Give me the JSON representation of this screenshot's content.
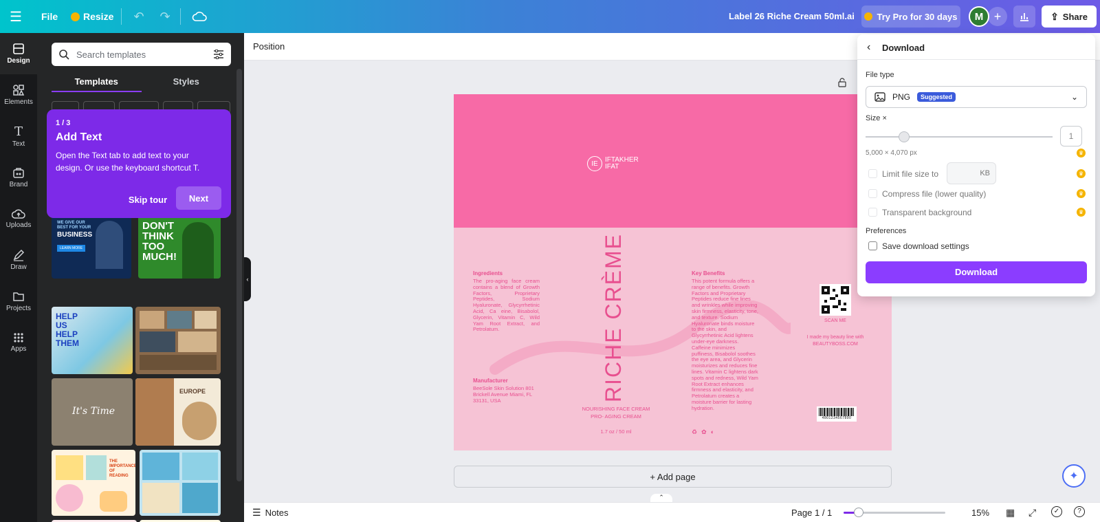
{
  "topbar": {
    "menu_icon": "hamburger-icon",
    "file_label": "File",
    "resize_label": "Resize",
    "doc_title": "Label 26 Riche Cream 50ml.ai",
    "try_pro_label": "Try Pro for 30 days",
    "avatar_letter": "M",
    "share_label": "Share"
  },
  "rail": {
    "items": [
      {
        "label": "Design",
        "icon": "design-icon"
      },
      {
        "label": "Elements",
        "icon": "elements-icon"
      },
      {
        "label": "Text",
        "icon": "text-icon"
      },
      {
        "label": "Brand",
        "icon": "brand-icon"
      },
      {
        "label": "Uploads",
        "icon": "uploads-icon"
      },
      {
        "label": "Draw",
        "icon": "draw-icon"
      },
      {
        "label": "Projects",
        "icon": "projects-icon"
      },
      {
        "label": "Apps",
        "icon": "apps-icon"
      }
    ]
  },
  "panel": {
    "search_placeholder": "Search templates",
    "tabs": [
      "Templates",
      "Styles"
    ],
    "thumbs": {
      "business_line1": "WE GIVE OUR",
      "business_line2": "BEST FOR YOUR",
      "business_line3": "BUSINESS",
      "business_cta": "LEARN MORE",
      "dont_think": "DON'T THINK TOO MUCH!",
      "help_us": "HELP US HELP THEM",
      "its_time": "It's Time",
      "europe": "EUROPE",
      "importance": "THE IMPORTANCE OF READING"
    }
  },
  "tour": {
    "step": "1 / 3",
    "title": "Add Text",
    "body": "Open the Text tab to add text to your design. Or use the keyboard shortcut T.",
    "skip_label": "Skip tour",
    "next_label": "Next"
  },
  "canvasbar": {
    "position_label": "Position"
  },
  "label": {
    "brand_line1": "IFTAKHER",
    "brand_line2": "IFAT",
    "brand_mark": "IE",
    "ingredients_title": "Ingredients",
    "ingredients_text": "The pro-aging face cream contains a blend of Growth Factors, Proprietary Peptides, Sodium Hyaluronate, Glycyrrhetinic Acid, Ca eine, Bisabolol, Glycerin, Vitamin C, Wild Yam Root Extract, and Petrolatum.",
    "manufacturer_title": "Manufacturer",
    "manufacturer_text": "BeeSole Skin Solution 801 Brickell Avenue Miami, FL 33131, USA",
    "product_name": "RICHE CRÈME",
    "subtitle1": "NOURISHING FACE CREAM",
    "subtitle2": "PRO- AGING CREAM",
    "volume": "1.7 oz / 50 ml",
    "benefits_title": "Key Benefits",
    "benefits_text": "This potent formula offers a range of benefits. Growth Factors and Proprietary Peptides reduce fine lines and wrinkles while improving skin firmness, elasticity, tone, and texture. Sodium Hyaluronate binds moisture to the skin, and Glycyrrhetinic Acid lightens under-eye darkness. Caffeine minimizes puffiness, Bisabolol soothes the eye area, and Glycerin moisturizes and reduces fine lines. Vitamin C lightens dark spots and redness, Wild Yam Root Extract enhances firmness and elasticity, and Petrolatum creates a moisture barrier for lasting hydration.",
    "scan_me": "SCAN ME",
    "made_line1": "I made my beauty line with",
    "made_line2": "BEAUTYBOSS.COM",
    "barcode_digits": "4801234567890"
  },
  "addpage_label": "+ Add page",
  "bottombar": {
    "notes_label": "Notes",
    "page_label": "Page 1 / 1",
    "zoom_label": "15%",
    "zoom_level": 0.15
  },
  "download": {
    "header": "Download",
    "file_type_label": "File type",
    "file_type_value": "PNG",
    "suggested_badge": "Suggested",
    "size_label": "Size ×",
    "size_value": "1",
    "dimensions": "5,000 × 4,070 px",
    "limit_label": "Limit file size to",
    "kb_label": "KB",
    "compress_label": "Compress file (lower quality)",
    "transparent_label": "Transparent background",
    "preferences_label": "Preferences",
    "save_settings_label": "Save download settings",
    "download_button": "Download"
  },
  "colors": {
    "accent": "#8b3dff",
    "label_pink": "#f76aa6",
    "label_light": "#f6c3d5",
    "text_pink": "#e84f8f"
  }
}
